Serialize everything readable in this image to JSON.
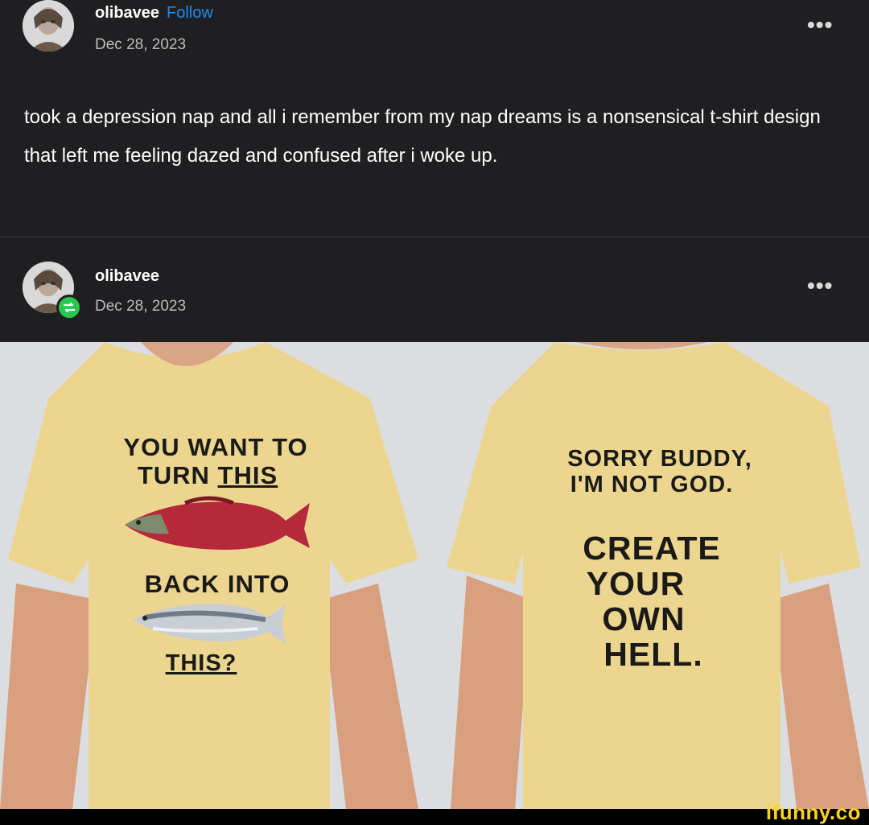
{
  "post": {
    "author": "olibavee",
    "follow_label": "Follow",
    "date": "Dec 28, 2023",
    "more_label": "•••",
    "body": "took a depression nap and all i remember from my nap dreams is a nonsensical t-shirt design that left me feeling dazed and confused after i woke up."
  },
  "reblog": {
    "author": "olibavee",
    "date": "Dec 28, 2023",
    "more_label": "•••"
  },
  "image": {
    "front": {
      "line1": "YOU WANT TO",
      "line2_prefix": "TURN ",
      "line2_underlined": "THIS",
      "line3": "BACK INTO",
      "line4": "THIS?"
    },
    "back": {
      "line1": "SORRY BUDDY,",
      "line2": "I'M NOT GOD.",
      "line3": "CREATE",
      "line4": "YOUR",
      "line5": "OWN",
      "line6": "HELL."
    }
  },
  "watermark": "ifunny.co",
  "colors": {
    "post_bg": "#1f1f21",
    "follow": "#1d8cf0",
    "reblog_badge": "#28c84a",
    "shirt": "#ecd68f",
    "watermark": "#ffd21f"
  },
  "icons": {
    "more": "more-horizontal-icon",
    "reblog": "reblog-icon"
  }
}
